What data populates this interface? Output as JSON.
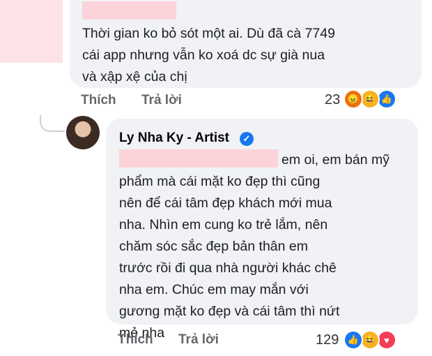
{
  "comment1": {
    "text": "Thời gian ko bỏ sót một ai. Dù đã cà 7749\ncái app nhưng vẫn ko xoá dc sự già nua\nvà xập xệ của chị",
    "like_label": "Thích",
    "reply_label": "Trả lời",
    "reaction_count": "23",
    "reactions": [
      "angry-reaction-icon",
      "haha-reaction-icon",
      "like-reaction-icon"
    ]
  },
  "comment2": {
    "author": "Ly Nha Ky - Artist",
    "text_first": "em oi, em bán mỹ",
    "text_rest": "phẩm mà cái mặt ko đẹp thì cũng\nnên để cái tâm đẹp khách mới mua\nnha. Nhìn em cung ko trẻ lắm, nên\nchăm sóc sắc đẹp bản thân em\ntrước rồi đi qua nhà người khác chê\nnha em. Chúc em may mắn với\ngương mặt ko đẹp và cái tâm thì nứt\nmẻ nha",
    "like_label": "Thích",
    "reply_label": "Trả lời",
    "reaction_count": "129",
    "reactions": [
      "like-reaction-icon",
      "haha-reaction-icon",
      "love-reaction-icon"
    ]
  },
  "colors": {
    "bubble": "#f0f2f5",
    "redaction": "#fbd3d8",
    "action_text": "#65676b",
    "verified": "#1877f2"
  }
}
